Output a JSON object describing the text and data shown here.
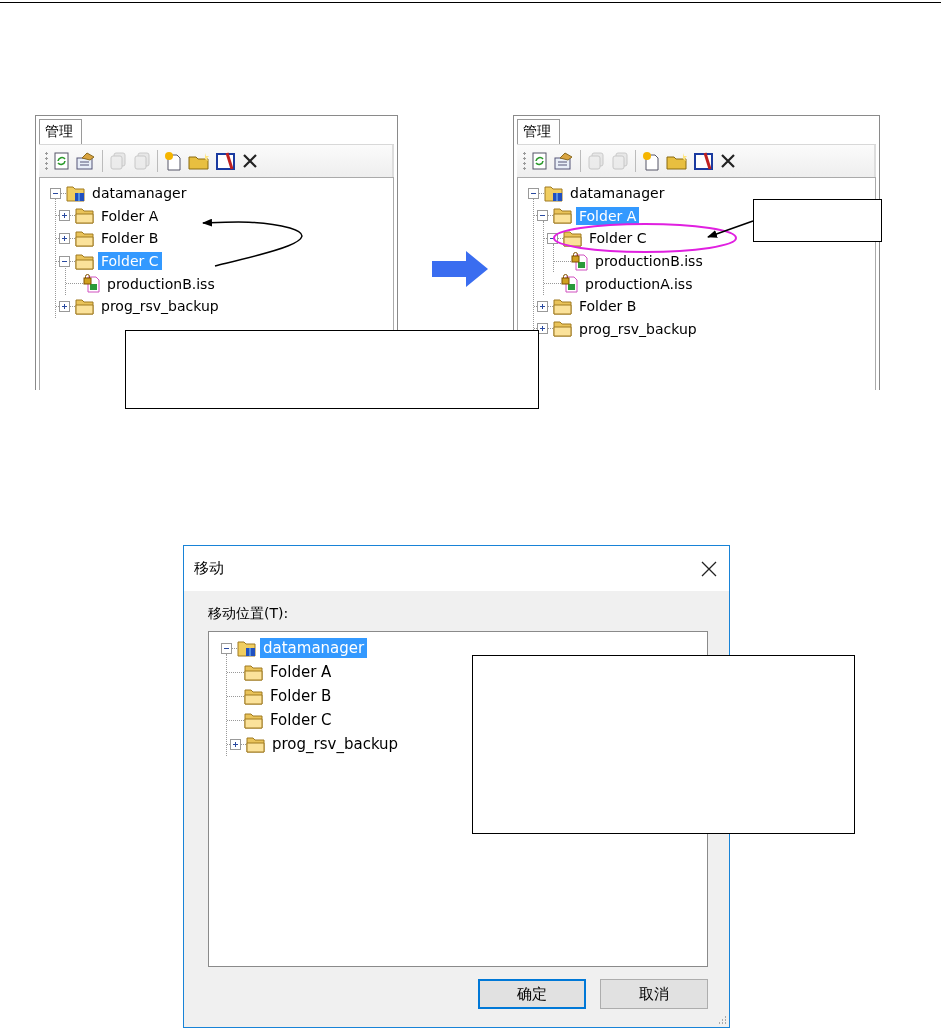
{
  "panels": [
    {
      "tab": "管理",
      "toolbar": [
        {
          "kind": "refresh",
          "disabled": false
        },
        {
          "kind": "properties",
          "disabled": false
        },
        {
          "kind": "copy",
          "disabled": true
        },
        {
          "kind": "paste",
          "disabled": true
        },
        {
          "kind": "new-file",
          "disabled": false
        },
        {
          "kind": "new-folder",
          "disabled": false
        },
        {
          "kind": "edit",
          "disabled": false
        },
        {
          "kind": "delete",
          "disabled": false
        }
      ],
      "tree": [
        {
          "label": "datamanager",
          "kind": "root",
          "expanded": true,
          "selected": false,
          "children": [
            {
              "label": "Folder A",
              "kind": "folder",
              "expanded": false,
              "selected": false
            },
            {
              "label": "Folder B",
              "kind": "folder",
              "expanded": false,
              "selected": false
            },
            {
              "label": "Folder C",
              "kind": "folder",
              "expanded": true,
              "selected": true,
              "children": [
                {
                  "label": "productionB.iss",
                  "kind": "file",
                  "selected": false
                }
              ]
            },
            {
              "label": "prog_rsv_backup",
              "kind": "folder",
              "expanded": false,
              "selected": false
            }
          ]
        }
      ]
    },
    {
      "tab": "管理",
      "toolbar": [
        {
          "kind": "refresh",
          "disabled": false
        },
        {
          "kind": "properties",
          "disabled": false
        },
        {
          "kind": "copy",
          "disabled": true
        },
        {
          "kind": "paste",
          "disabled": true
        },
        {
          "kind": "new-file",
          "disabled": false
        },
        {
          "kind": "new-folder",
          "disabled": false
        },
        {
          "kind": "edit",
          "disabled": false
        },
        {
          "kind": "delete",
          "disabled": false
        }
      ],
      "tree": [
        {
          "label": "datamanager",
          "kind": "root",
          "expanded": true,
          "selected": false,
          "children": [
            {
              "label": "Folder A",
              "kind": "folder",
              "expanded": true,
              "selected": true,
              "children": [
                {
                  "label": "Folder C",
                  "kind": "folder",
                  "expanded": true,
                  "selected": false,
                  "children": [
                    {
                      "label": "productionB.iss",
                      "kind": "file",
                      "selected": false
                    }
                  ]
                },
                {
                  "label": "productionA.iss",
                  "kind": "file",
                  "selected": false
                }
              ]
            },
            {
              "label": "Folder B",
              "kind": "folder",
              "expanded": false,
              "selected": false
            },
            {
              "label": "prog_rsv_backup",
              "kind": "folder",
              "expanded": false,
              "selected": false
            }
          ]
        }
      ]
    }
  ],
  "dialog": {
    "title": "移动",
    "tree_label": "移动位置(T):",
    "tree": [
      {
        "label": "datamanager",
        "kind": "root",
        "expanded": true,
        "selected": true,
        "children": [
          {
            "label": "Folder A",
            "kind": "folder",
            "selected": false
          },
          {
            "label": "Folder B",
            "kind": "folder",
            "selected": false
          },
          {
            "label": "Folder C",
            "kind": "folder",
            "selected": false
          },
          {
            "label": "prog_rsv_backup",
            "kind": "folder",
            "expanded": false,
            "selected": false
          }
        ]
      }
    ],
    "buttons": [
      {
        "label": "确定",
        "default": true
      },
      {
        "label": "取消",
        "default": false
      }
    ]
  }
}
